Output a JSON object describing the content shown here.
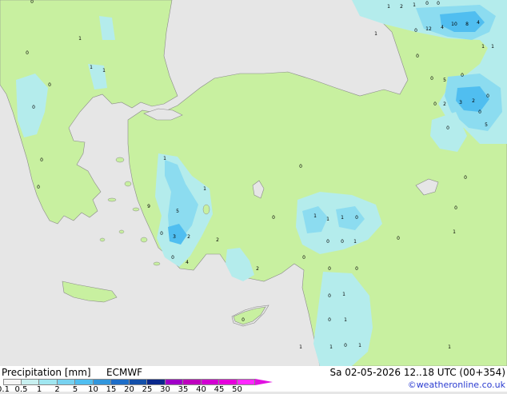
{
  "footer": {
    "title": "Precipitation [mm]",
    "model": "ECMWF",
    "datetime": "Sa 02-05-2026 12..18 UTC (00+354)",
    "credit": "©weatheronline.co.uk"
  },
  "legend": {
    "ticks": [
      "0.1",
      "0.5",
      "1",
      "2",
      "5",
      "10",
      "15",
      "20",
      "25",
      "30",
      "35",
      "40",
      "45",
      "50"
    ],
    "colors": [
      "#f5f5f5",
      "#c8f0f0",
      "#a0e6f0",
      "#78d2f0",
      "#50bef0",
      "#3296dc",
      "#1e6ec8",
      "#1450aa",
      "#0a288c",
      "#a000c8",
      "#be00be",
      "#d200d2",
      "#e600dc",
      "#ff28ff"
    ]
  },
  "map": {
    "colors": {
      "sea": "#e6e6e6",
      "land": "#c8f0a0",
      "rain_light": "#b4ecec",
      "rain_mid": "#8cdcf0",
      "rain_heavy": "#50bef0"
    },
    "labels": [
      "0",
      "1",
      "2",
      "1",
      "0",
      "0",
      "12",
      "4",
      "10",
      "8",
      "4",
      "1",
      "0",
      "1",
      "1",
      "0",
      "1",
      "1",
      "1",
      "0",
      "0",
      "0",
      "0",
      "0",
      "2",
      "3",
      "2",
      "0",
      "5",
      "0",
      "0",
      "1",
      "0",
      "0",
      "1",
      "9",
      "5",
      "1",
      "0",
      "3",
      "2",
      "2",
      "0",
      "4",
      "1",
      "1",
      "0",
      "0",
      "0",
      "1",
      "0",
      "1",
      "2",
      "0",
      "0",
      "0",
      "1",
      "0",
      "1",
      "0",
      "1",
      "1",
      "0",
      "1",
      "1",
      "0",
      "0",
      "0",
      "5",
      "0",
      "0",
      "0"
    ]
  }
}
